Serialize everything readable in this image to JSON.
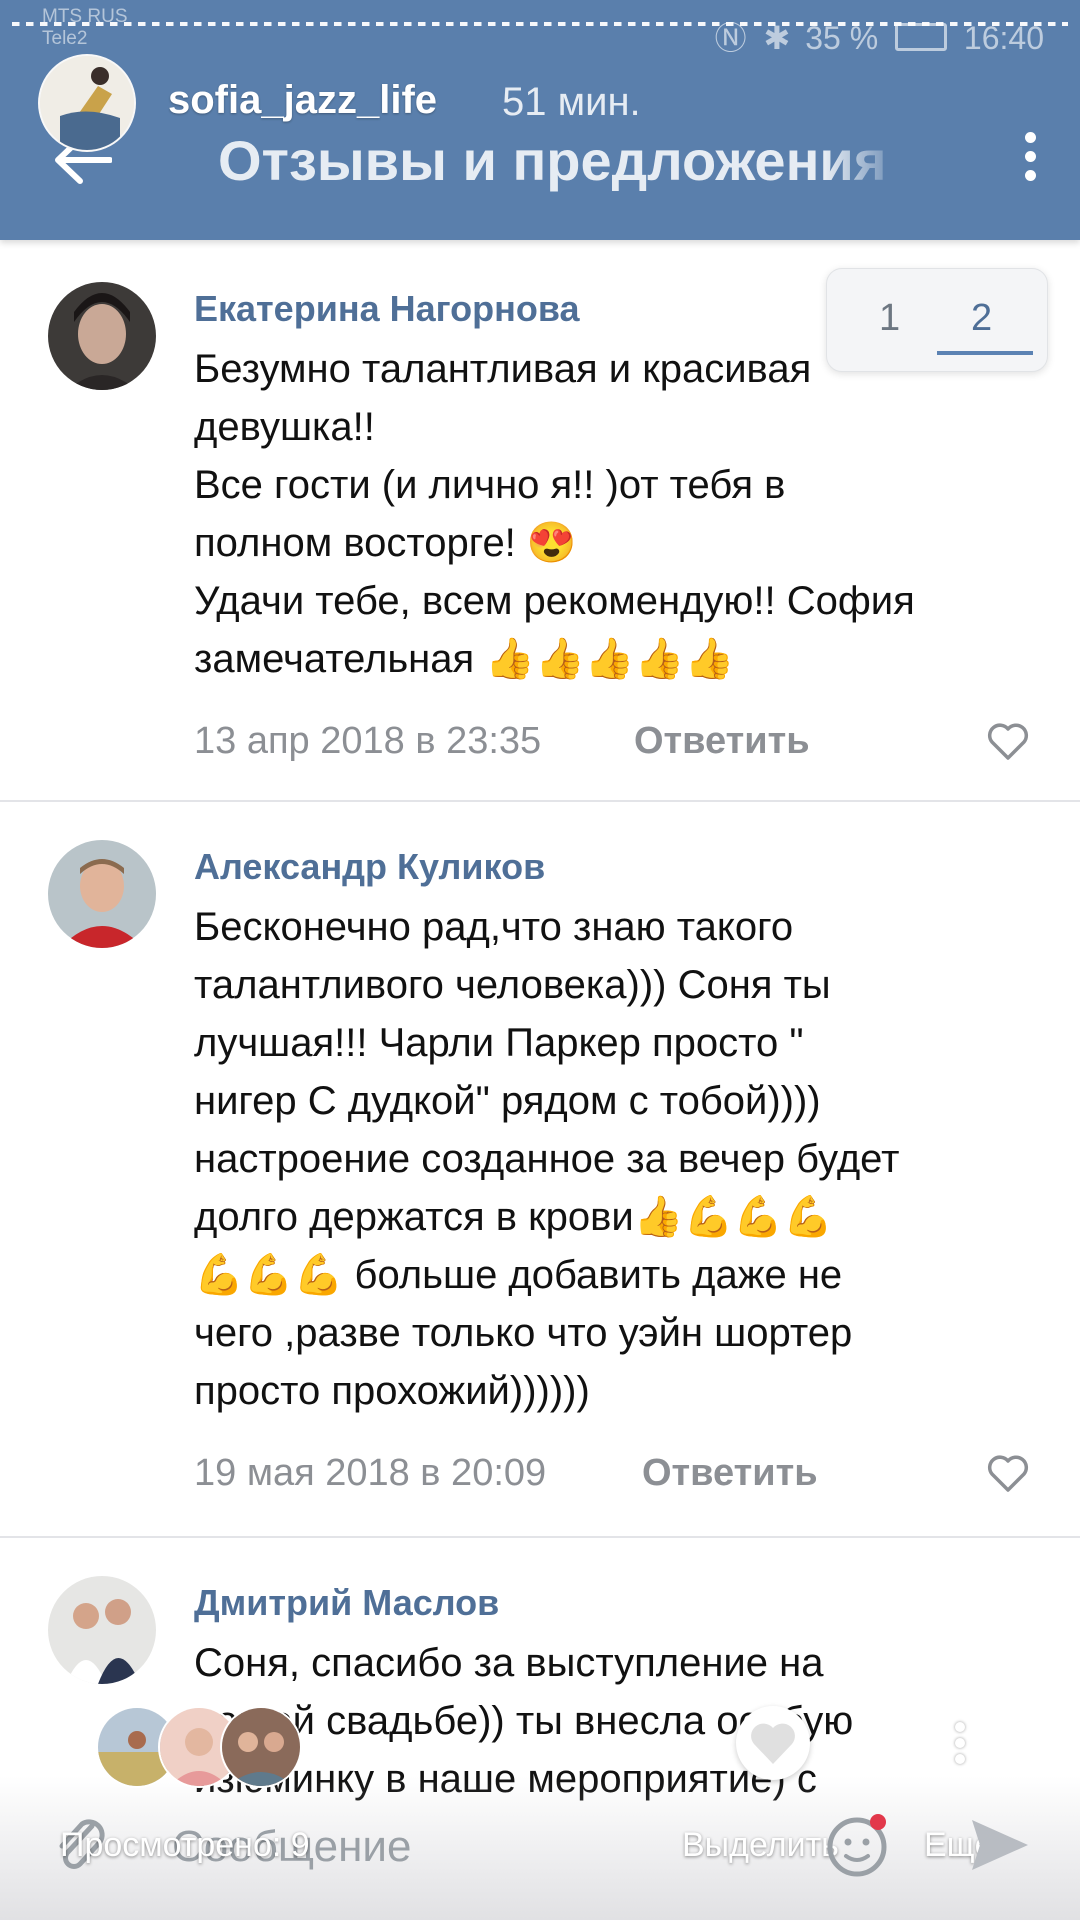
{
  "status_bar": {
    "carrier1": "MTS RUS",
    "carrier2": "Tele2",
    "battery": "35 %",
    "time": "16:40"
  },
  "story": {
    "username": "sofia_jazz_life",
    "time_ago": "51 мин."
  },
  "header": {
    "title": "Отзывы и предложения"
  },
  "pager": {
    "pages": [
      "1",
      "2"
    ],
    "current": "2"
  },
  "comments": [
    {
      "author": "Екатерина Нагорнова",
      "text": "Безумно талантливая и красивая\nдевушка!!\nВсе гости (и лично я!! )от тебя в\nполном восторге! 😍\nУдачи тебе, всем рекомендую!! София\nзамечательная 👍👍👍👍👍",
      "date": "13 апр 2018 в 23:35",
      "reply": "Ответить"
    },
    {
      "author": "Александр Куликов",
      "text": "Бесконечно рад,что знаю такого\nталантливого человека))) Соня ты\nлучшая!!! Чарли Паркер просто \"\nнигер С дудкой\" рядом с тобой))))\nнастроение созданное за вечер будет\nдолго держатся в крови👍💪💪💪\n💪💪💪  больше добавить даже не\nчего ,разве только что уэйн шортер\nпросто прохожий))))))",
      "date": "19 мая 2018 в 20:09",
      "reply": "Ответить"
    },
    {
      "author": "Дмитрий Маслов",
      "text": "Соня, спасибо за выступление на\nнашей свадьбе)) ты внесла особую\nизюминку в наше мероприятие) с",
      "date": "",
      "reply": ""
    }
  ],
  "bottom": {
    "viewed": "Просмотрено: 9",
    "message_placeholder": "Сообщение",
    "select": "Выделить",
    "more": "Ещё"
  },
  "colors": {
    "header_bg": "#5a7fac",
    "author_link": "#4f6f97",
    "meta_gray": "#8c8f94"
  },
  "icons": [
    "back-arrow-icon",
    "kebab-menu-icon",
    "heart-icon",
    "attach-icon",
    "sticker-icon",
    "send-icon"
  ]
}
